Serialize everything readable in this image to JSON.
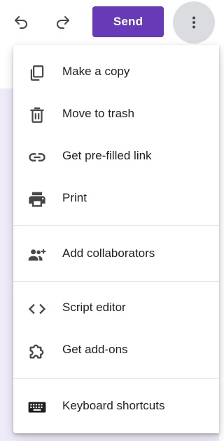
{
  "toolbar": {
    "undo_icon": "undo-icon",
    "redo_icon": "redo-icon",
    "send_label": "Send",
    "more_icon": "more-vert-icon"
  },
  "colors": {
    "accent": "#673ab7",
    "background_tint": "#f0ebf8",
    "text": "#202124",
    "icon": "#5f6368"
  },
  "menu": {
    "items": [
      {
        "label": "Make a copy",
        "icon": "copy-icon"
      },
      {
        "label": "Move to trash",
        "icon": "trash-icon"
      },
      {
        "label": "Get pre-filled link",
        "icon": "link-icon"
      },
      {
        "label": "Print",
        "icon": "printer-icon"
      },
      {
        "label": "Add collaborators",
        "icon": "add-people-icon"
      },
      {
        "label": "Script editor",
        "icon": "code-icon"
      },
      {
        "label": "Get add-ons",
        "icon": "puzzle-icon"
      },
      {
        "label": "Keyboard shortcuts",
        "icon": "keyboard-icon"
      }
    ]
  }
}
